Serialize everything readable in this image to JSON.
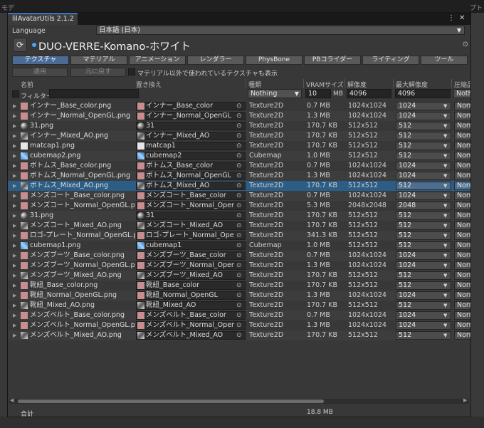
{
  "background": {
    "left_text": "モデ",
    "right_text": "プト"
  },
  "window": {
    "tab_title": "lilAvatarUtils 2.1.2",
    "menu_icon": "kebab-menu-icon",
    "close_icon": "close-icon",
    "menu_glyph": "⋮",
    "close_glyph": "✕"
  },
  "language": {
    "label": "Language",
    "value": "日本語 (日本)"
  },
  "header": {
    "avatar_name": "DUO-VERRE-Komano-ホワイト"
  },
  "category_tabs": [
    {
      "label": "テクスチャ",
      "active": true
    },
    {
      "label": "マテリアル",
      "active": false
    },
    {
      "label": "アニメーション",
      "active": false
    },
    {
      "label": "レンダラー",
      "active": false
    },
    {
      "label": "PhysBone",
      "active": false
    },
    {
      "label": "PBコライダー",
      "active": false
    },
    {
      "label": "ライティング",
      "active": false
    },
    {
      "label": "ツール",
      "active": false
    }
  ],
  "actions": {
    "apply": "適用",
    "revert": "元に戻す",
    "show_unused_label": "マテリアル以外で使われているテクスチャも表示"
  },
  "columns": {
    "name": "名前",
    "replace": "置き換え",
    "type": "種類",
    "vram": "VRAMサイズ",
    "resolution": "解像度",
    "max_resolution": "最大解像度",
    "compression": "圧縮品"
  },
  "filter": {
    "label": "フィルター",
    "type_value": "Nothing",
    "vram_value": "10",
    "vram_unit": "MB",
    "res_value": "4096",
    "maxres_value": "4096",
    "comp_value": "Nothing"
  },
  "rows": [
    {
      "name": "インナー_Base_color.png",
      "replace": "インナー_Base_color",
      "type": "Texture2D",
      "vram": "0.7 MB",
      "res": "1024x1024",
      "maxres": "1024",
      "comp": "Normal",
      "thumb": "c-pink"
    },
    {
      "name": "インナー_Normal_OpenGL.png",
      "replace": "インナー_Normal_OpenGL",
      "type": "Texture2D",
      "vram": "1.3 MB",
      "res": "1024x1024",
      "maxres": "1024",
      "comp": "Normal",
      "thumb": "c-pink"
    },
    {
      "name": "31.png",
      "replace": "31",
      "type": "Texture2D",
      "vram": "170.7 KB",
      "res": "512x512",
      "maxres": "512",
      "comp": "Normal",
      "thumb": "c-sphere"
    },
    {
      "name": "インナー_Mixed_AO.png",
      "replace": "インナー_Mixed_AO",
      "type": "Texture2D",
      "vram": "170.7 KB",
      "res": "512x512",
      "maxres": "512",
      "comp": "Normal",
      "thumb": "c-ao"
    },
    {
      "name": "matcap1.png",
      "replace": "matcap1",
      "type": "Texture2D",
      "vram": "170.7 KB",
      "res": "512x512",
      "maxres": "512",
      "comp": "Normal",
      "thumb": "c-white"
    },
    {
      "name": "cubemap2.png",
      "replace": "cubemap2",
      "type": "Cubemap",
      "vram": "1.0 MB",
      "res": "512x512",
      "maxres": "512",
      "comp": "Normal",
      "thumb": "c-cube"
    },
    {
      "name": "ボトムス_Base_color.png",
      "replace": "ボトムス_Base_color",
      "type": "Texture2D",
      "vram": "0.7 MB",
      "res": "1024x1024",
      "maxres": "1024",
      "comp": "Normal",
      "thumb": "c-pink"
    },
    {
      "name": "ボトムス_Normal_OpenGL.png",
      "replace": "ボトムス_Normal_OpenGL",
      "type": "Texture2D",
      "vram": "1.3 MB",
      "res": "1024x1024",
      "maxres": "1024",
      "comp": "Normal",
      "thumb": "c-pink"
    },
    {
      "name": "ボトムス_Mixed_AO.png",
      "replace": "ボトムス_Mixed_AO",
      "type": "Texture2D",
      "vram": "170.7 KB",
      "res": "512x512",
      "maxres": "512",
      "comp": "Normal",
      "thumb": "c-ao",
      "selected": true
    },
    {
      "name": "メンズコート_Base_color.png",
      "replace": "メンズコート_Base_color",
      "type": "Texture2D",
      "vram": "0.7 MB",
      "res": "1024x1024",
      "maxres": "1024",
      "comp": "Normal",
      "thumb": "c-pink"
    },
    {
      "name": "メンズコート_Normal_OpenGL.png",
      "replace": "メンズコート_Normal_OpenGL",
      "type": "Texture2D",
      "vram": "5.3 MB",
      "res": "2048x2048",
      "maxres": "2048",
      "comp": "Normal",
      "thumb": "c-pink"
    },
    {
      "name": "31.png",
      "replace": "31",
      "type": "Texture2D",
      "vram": "170.7 KB",
      "res": "512x512",
      "maxres": "512",
      "comp": "Normal",
      "thumb": "c-sphere"
    },
    {
      "name": "メンズコート_Mixed_AO.png",
      "replace": "メンズコート_Mixed_AO",
      "type": "Texture2D",
      "vram": "170.7 KB",
      "res": "512x512",
      "maxres": "512",
      "comp": "Normal",
      "thumb": "c-ao"
    },
    {
      "name": "ロゴ-プレート_Normal_OpenGL.png",
      "replace": "ロゴ-プレート_Normal_OpenGL",
      "type": "Texture2D",
      "vram": "341.3 KB",
      "res": "512x512",
      "maxres": "512",
      "comp": "Normal",
      "thumb": "c-pink"
    },
    {
      "name": "cubemap1.png",
      "replace": "cubemap1",
      "type": "Cubemap",
      "vram": "1.0 MB",
      "res": "512x512",
      "maxres": "512",
      "comp": "Normal",
      "thumb": "c-cube"
    },
    {
      "name": "メンズブーツ_Base_color.png",
      "replace": "メンズブーツ_Base_color",
      "type": "Texture2D",
      "vram": "0.7 MB",
      "res": "1024x1024",
      "maxres": "1024",
      "comp": "Normal",
      "thumb": "c-pink"
    },
    {
      "name": "メンズブーツ_Normal_OpenGL.png",
      "replace": "メンズブーツ_Normal_OpenGL",
      "type": "Texture2D",
      "vram": "1.3 MB",
      "res": "1024x1024",
      "maxres": "1024",
      "comp": "Normal",
      "thumb": "c-pink"
    },
    {
      "name": "メンズブーツ_Mixed_AO.png",
      "replace": "メンズブーツ_Mixed_AO",
      "type": "Texture2D",
      "vram": "170.7 KB",
      "res": "512x512",
      "maxres": "512",
      "comp": "Normal",
      "thumb": "c-ao"
    },
    {
      "name": "靴紐_Base_color.png",
      "replace": "靴紐_Base_color",
      "type": "Texture2D",
      "vram": "170.7 KB",
      "res": "512x512",
      "maxres": "512",
      "comp": "Normal",
      "thumb": "c-pink"
    },
    {
      "name": "靴紐_Normal_OpenGL.png",
      "replace": "靴紐_Normal_OpenGL",
      "type": "Texture2D",
      "vram": "1.3 MB",
      "res": "1024x1024",
      "maxres": "1024",
      "comp": "Normal",
      "thumb": "c-pink"
    },
    {
      "name": "靴紐_Mixed_AO.png",
      "replace": "靴紐_Mixed_AO",
      "type": "Texture2D",
      "vram": "170.7 KB",
      "res": "512x512",
      "maxres": "512",
      "comp": "Normal",
      "thumb": "c-ao"
    },
    {
      "name": "メンズベルト_Base_color.png",
      "replace": "メンズベルト_Base_color",
      "type": "Texture2D",
      "vram": "0.7 MB",
      "res": "1024x1024",
      "maxres": "1024",
      "comp": "Normal",
      "thumb": "c-pink"
    },
    {
      "name": "メンズベルト_Normal_OpenGL.png",
      "replace": "メンズベルト_Normal_OpenGL",
      "type": "Texture2D",
      "vram": "1.3 MB",
      "res": "1024x1024",
      "maxres": "1024",
      "comp": "Normal",
      "thumb": "c-pink"
    },
    {
      "name": "メンズベルト_Mixed_AO.png",
      "replace": "メンズベルト_Mixed_AO",
      "type": "Texture2D",
      "vram": "170.7 KB",
      "res": "512x512",
      "maxres": "512",
      "comp": "Normal",
      "thumb": "c-ao"
    }
  ],
  "footer": {
    "label": "合計",
    "total": "18.8 MB"
  },
  "icons": {
    "refresh": "refresh-icon",
    "gear": "gear-icon",
    "object_target": "object-picker-icon",
    "fold": "foldout-arrow-icon",
    "refresh_glyph": "⟳",
    "gear_glyph": "⊙",
    "target_glyph": "⊙",
    "fold_glyph": "▶",
    "dropdown_glyph": "▼"
  },
  "colors": {
    "accent": "#3b78c4",
    "selected_row": "#2c5d87",
    "active_tab": "#4a6b95"
  }
}
